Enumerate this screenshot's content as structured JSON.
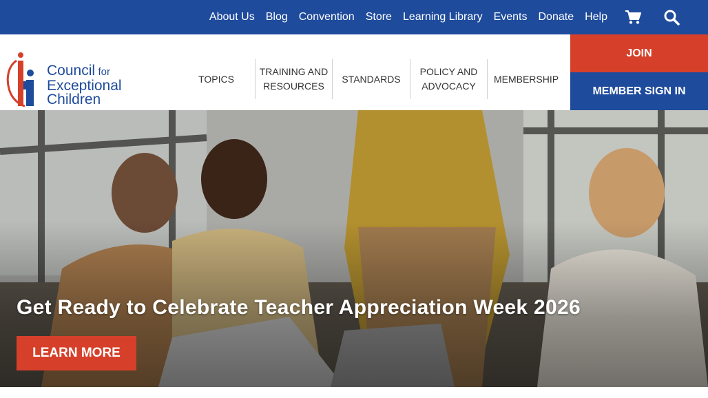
{
  "topbar": {
    "links": [
      "About Us",
      "Blog",
      "Convention",
      "Store",
      "Learning Library",
      "Events",
      "Donate",
      "Help"
    ],
    "cart_icon": "cart-icon",
    "search_icon": "search-icon"
  },
  "logo": {
    "line1": "Council",
    "line1_small": "for",
    "line2": "Exceptional",
    "line3": "Children"
  },
  "nav": {
    "topics": "TOPICS",
    "training_1": "TRAINING AND",
    "training_2": "RESOURCES",
    "standards": "STANDARDS",
    "policy_1": "POLICY AND",
    "policy_2": "ADVOCACY",
    "membership": "MEMBERSHIP"
  },
  "actions": {
    "join": "JOIN",
    "sign_in": "MEMBER SIGN IN"
  },
  "hero": {
    "headline": "Get Ready to Celebrate Teacher Appreciation Week 2026",
    "cta": "LEARN MORE"
  },
  "colors": {
    "brand_blue": "#1f4b9c",
    "brand_red": "#d6402a"
  }
}
